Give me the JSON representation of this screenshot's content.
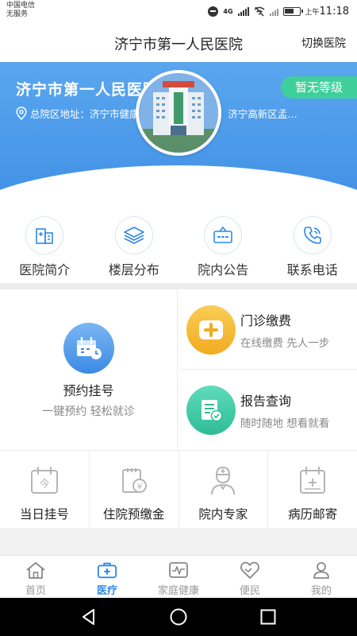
{
  "status_bar": {
    "carrier": "中国电信",
    "service": "无服务",
    "network": "4G",
    "time_prefix": "上午",
    "time": "11:18"
  },
  "header": {
    "title": "济宁市第一人民医院",
    "switch_label": "切换医院"
  },
  "banner": {
    "hospital_name": "济宁市第一人民医院",
    "level_badge": "暂无等级",
    "address": "总院区地址：济宁市健康路6号 东院区地址：济宁高新区孟…",
    "icon": "location-pin-icon"
  },
  "info_items": [
    {
      "label": "医院简介",
      "icon": "hospital-building-icon"
    },
    {
      "label": "楼层分布",
      "icon": "layers-icon"
    },
    {
      "label": "院内公告",
      "icon": "notice-board-icon"
    },
    {
      "label": "联系电话",
      "icon": "phone-icon"
    }
  ],
  "services": {
    "appointment": {
      "title": "预约挂号",
      "subtitle": "一键预约 轻松就诊",
      "icon": "calendar-clock-icon"
    },
    "payment": {
      "title": "门诊缴费",
      "subtitle": "在线缴费 先人一步",
      "icon": "medical-plus-icon"
    },
    "report": {
      "title": "报告查询",
      "subtitle": "随时随地 想看就看",
      "icon": "report-check-icon"
    }
  },
  "service_row": [
    {
      "label": "当日挂号",
      "icon": "today-calendar-icon",
      "icon_text": "今"
    },
    {
      "label": "住院预缴金",
      "icon": "deposit-icon",
      "icon_text": "¥"
    },
    {
      "label": "院内专家",
      "icon": "doctor-icon"
    },
    {
      "label": "病历邮寄",
      "icon": "medical-record-icon"
    }
  ],
  "tabs": [
    {
      "label": "首页",
      "icon": "home-icon",
      "active": false
    },
    {
      "label": "医疗",
      "icon": "medical-kit-icon",
      "active": true
    },
    {
      "label": "家庭健康",
      "icon": "heartbeat-icon",
      "active": false
    },
    {
      "label": "便民",
      "icon": "heart-hand-icon",
      "active": false
    },
    {
      "label": "我的",
      "icon": "user-icon",
      "active": false
    }
  ],
  "colors": {
    "primary": "#2f88e6",
    "badge": "#3fcf9d",
    "payment_icon": "#f5b731",
    "report_icon": "#3dc9a6",
    "muted_icon": "#b5b5b5"
  }
}
